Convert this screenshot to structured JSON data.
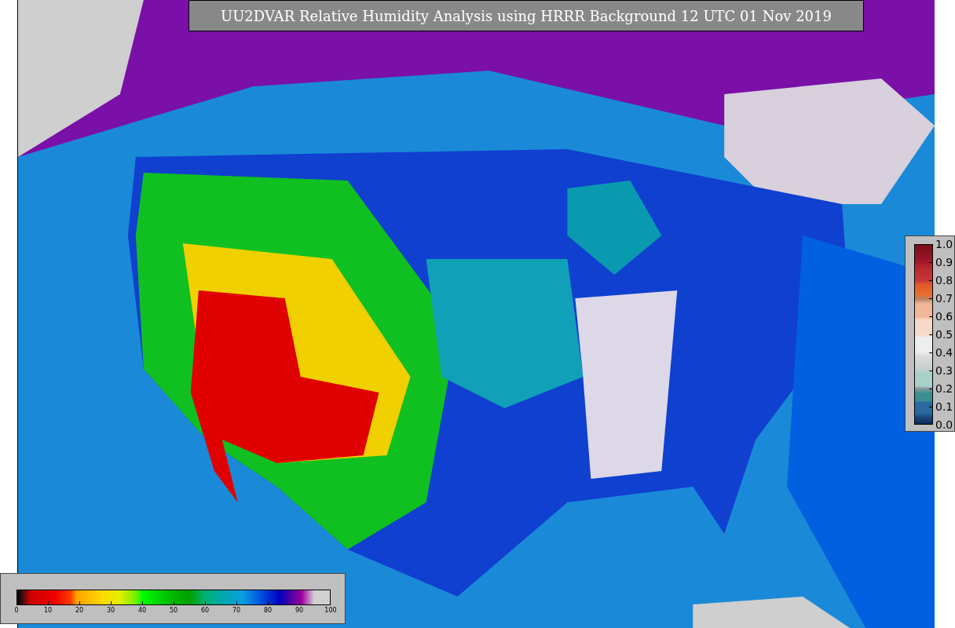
{
  "title": "UU2DVAR Relative Humidity Analysis using HRRR Background 12 UTC 01 Nov 2019",
  "colorbars": [
    {
      "kind": "horizontal",
      "ticks": [
        "0",
        "10",
        "20",
        "30",
        "40",
        "50",
        "60",
        "70",
        "80",
        "90",
        "100"
      ]
    },
    {
      "kind": "vertical",
      "ticks": [
        "1.0",
        "0.9",
        "0.8",
        "0.7",
        "0.6",
        "0.5",
        "0.4",
        "0.3",
        "0.2",
        "0.1",
        "0.0"
      ]
    }
  ]
}
